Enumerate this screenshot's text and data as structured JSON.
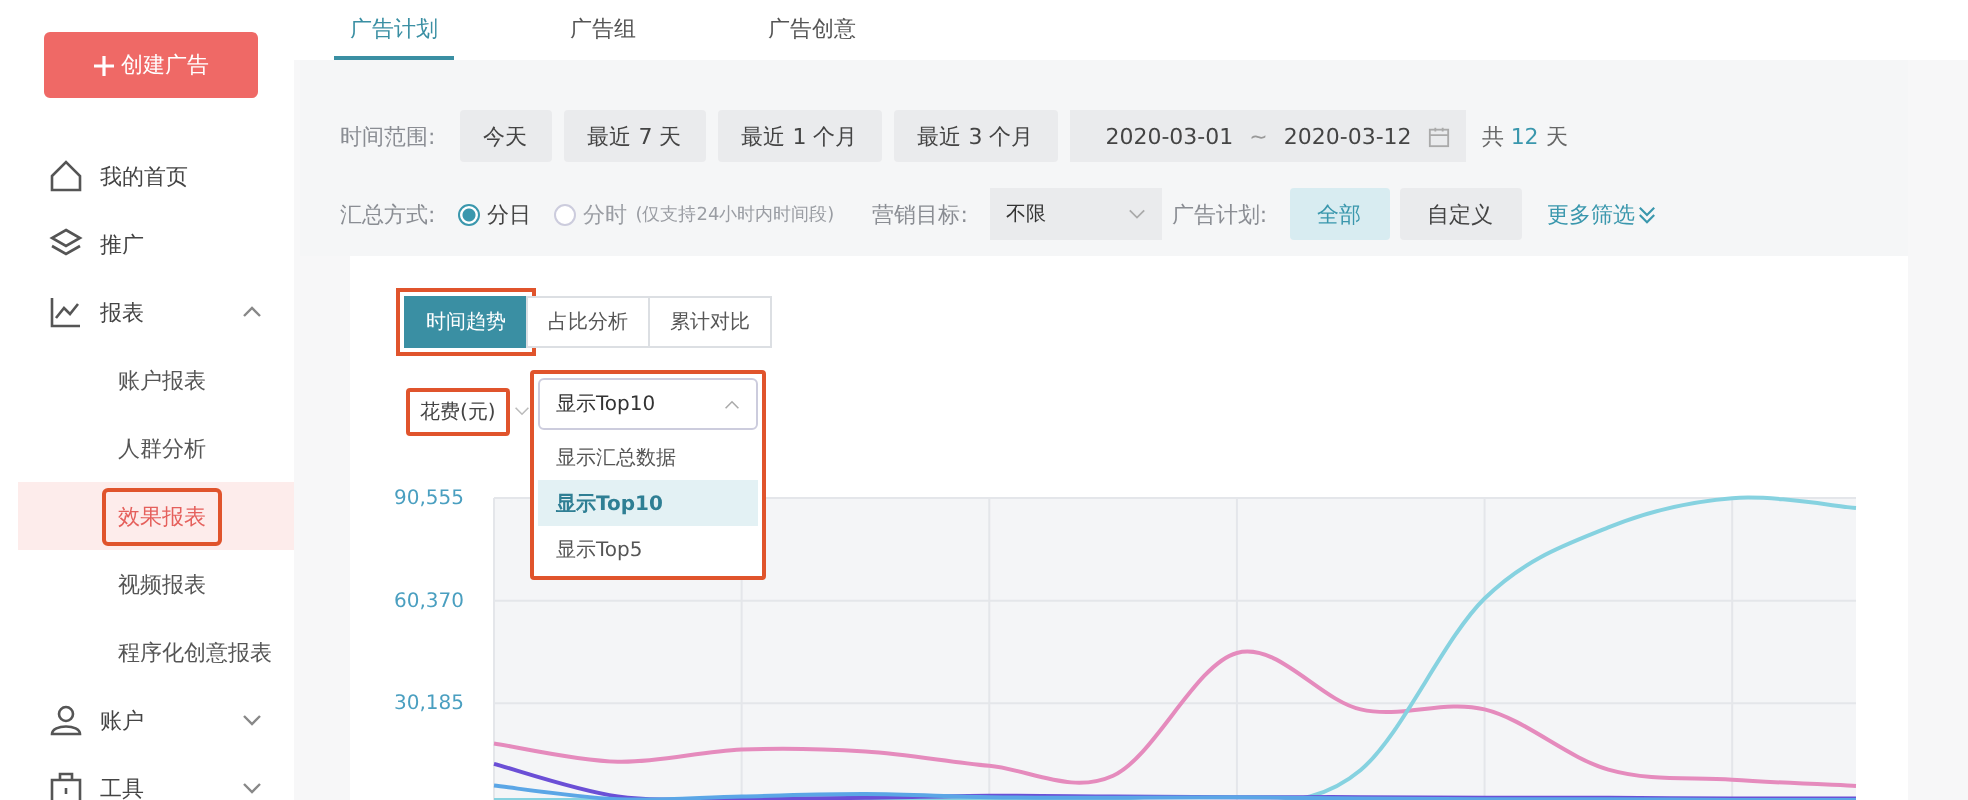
{
  "sidebar": {
    "create_button": "创建广告",
    "items": [
      {
        "label": "我的首页",
        "selected": false
      },
      {
        "label": "推广",
        "selected": false
      },
      {
        "label": "报表",
        "selected": false,
        "expanded": true,
        "children": [
          {
            "label": "账户报表",
            "selected": false,
            "highlighted": false
          },
          {
            "label": "人群分析",
            "selected": false,
            "highlighted": false
          },
          {
            "label": "效果报表",
            "selected": true,
            "highlighted": true
          },
          {
            "label": "视频报表",
            "selected": false,
            "highlighted": false
          },
          {
            "label": "程序化创意报表",
            "selected": false,
            "highlighted": false
          }
        ]
      },
      {
        "label": "账户",
        "selected": false,
        "expanded": false
      },
      {
        "label": "工具",
        "selected": false,
        "expanded": false
      }
    ]
  },
  "tabs": [
    {
      "label": "广告计划",
      "selected": true
    },
    {
      "label": "广告组",
      "selected": false
    },
    {
      "label": "广告创意",
      "selected": false
    }
  ],
  "filters": {
    "time_range": {
      "label": "时间范围:",
      "options": [
        {
          "label": "今天",
          "selected": false
        },
        {
          "label": "最近 7 天",
          "selected": false
        },
        {
          "label": "最近 1 个月",
          "selected": false
        },
        {
          "label": "最近 3 个月",
          "selected": false
        }
      ],
      "start_date": "2020-03-01",
      "separator": "~",
      "end_date": "2020-03-12",
      "total_prefix": "共",
      "total_days": "12",
      "total_suffix": "天"
    },
    "aggregation": {
      "label": "汇总方式:",
      "options": [
        {
          "label": "分日",
          "selected": true,
          "disabled": false
        },
        {
          "label": "分时",
          "note": "(仅支持24小时内时间段)",
          "selected": false,
          "disabled": true
        }
      ]
    },
    "marketing_goal": {
      "label": "营销目标:",
      "value": "不限"
    },
    "ad_plan": {
      "label": "广告计划:",
      "options": [
        {
          "label": "全部",
          "selected": true
        },
        {
          "label": "自定义",
          "selected": false
        }
      ]
    },
    "more_filters": "更多筛选"
  },
  "chart_panel": {
    "view_tabs": [
      {
        "label": "时间趋势",
        "selected": true,
        "highlighted": true
      },
      {
        "label": "占比分析",
        "selected": false,
        "highlighted": false
      },
      {
        "label": "累计对比",
        "selected": false,
        "highlighted": false
      }
    ],
    "metric": {
      "value": "花费(元)",
      "highlighted": true
    },
    "display_select": {
      "value": "显示Top10",
      "expanded": true,
      "highlighted": true,
      "options": [
        {
          "label": "显示汇总数据",
          "selected": false
        },
        {
          "label": "显示Top10",
          "selected": true
        },
        {
          "label": "显示Top5",
          "selected": false
        }
      ]
    },
    "chart_data": {
      "type": "line",
      "grid": true,
      "ylim": [
        0,
        90555
      ],
      "yticks": [
        {
          "value": 30185,
          "label": "30,185"
        },
        {
          "value": 60370,
          "label": "60,370"
        },
        {
          "value": 90555,
          "label": "90,555"
        }
      ],
      "series": [
        {
          "color": "#e58bbd",
          "values": [
            18400,
            13000,
            16600,
            16000,
            11800,
            8900,
            45000,
            28400,
            28400,
            10700,
            7700,
            5900
          ]
        },
        {
          "color": "#86d2e0",
          "values": [
            1800,
            1800,
            1800,
            1800,
            1800,
            1800,
            0,
            10600,
            61000,
            81900,
            90500,
            87600
          ]
        },
        {
          "color": "#6b4fd6",
          "values": [
            12400,
            2800,
            2200,
            2400,
            3000,
            2800,
            2600,
            2600,
            2400,
            2400,
            2200,
            2200
          ]
        },
        {
          "color": "#5ba6e6",
          "values": [
            6000,
            2000,
            2800,
            3500,
            2600,
            2400,
            2600,
            2200,
            2000,
            2000,
            1800,
            1800
          ]
        }
      ]
    }
  }
}
